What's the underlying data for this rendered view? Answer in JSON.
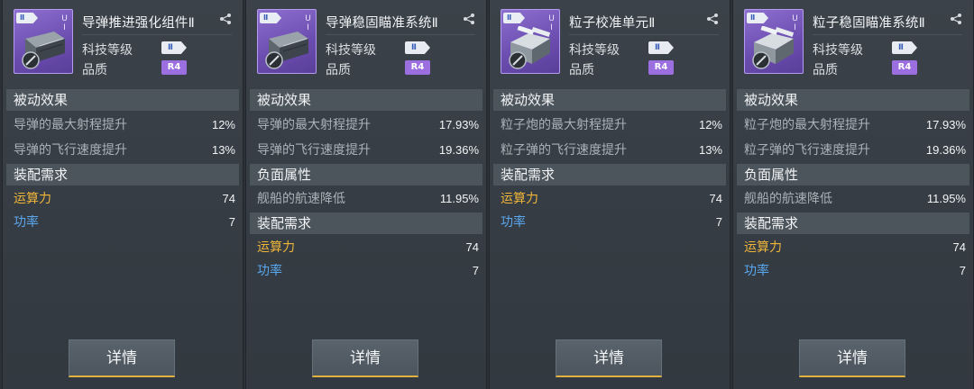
{
  "labels": {
    "tech_level": "科技等级",
    "quality": "品质",
    "passive_effects": "被动效果",
    "negative_attributes": "负面属性",
    "requirements": "装配需求",
    "compute": "运算力",
    "power": "功率",
    "details_button": "详情"
  },
  "colors": {
    "thumb_purple": "#7a5cc2",
    "quality_badge": "#9b6fe0",
    "compute_label": "#f0b63a",
    "power_label": "#5aa7ee",
    "button_underline": "#e2b23f"
  },
  "cards": [
    {
      "title": "导弹推进强化组件Ⅱ",
      "tier_chip": "Ⅱ",
      "side_mark": "U I",
      "level_badge": "Ⅱ",
      "quality_badge": "R4",
      "passives": [
        {
          "label": "导弹的最大射程提升",
          "value": "12%"
        },
        {
          "label": "导弹的飞行速度提升",
          "value": "13%"
        }
      ],
      "negatives": [],
      "compute": "74",
      "power": "7",
      "icon": "missile-module-icon"
    },
    {
      "title": "导弹稳固瞄准系统Ⅱ",
      "tier_chip": "Ⅱ",
      "side_mark": "U I",
      "level_badge": "Ⅱ",
      "quality_badge": "R4",
      "passives": [
        {
          "label": "导弹的最大射程提升",
          "value": "17.93%"
        },
        {
          "label": "导弹的飞行速度提升",
          "value": "19.36%"
        }
      ],
      "negatives": [
        {
          "label": "舰船的航速降低",
          "value": "11.95%"
        }
      ],
      "compute": "74",
      "power": "7",
      "icon": "missile-module-icon"
    },
    {
      "title": "粒子校准单元Ⅱ",
      "tier_chip": "Ⅱ",
      "side_mark": "U I",
      "level_badge": "Ⅱ",
      "quality_badge": "R4",
      "passives": [
        {
          "label": "粒子炮的最大射程提升",
          "value": "12%"
        },
        {
          "label": "粒子弹的飞行速度提升",
          "value": "13%"
        }
      ],
      "negatives": [],
      "compute": "74",
      "power": "7",
      "icon": "particle-module-icon"
    },
    {
      "title": "粒子稳固瞄准系统Ⅱ",
      "tier_chip": "Ⅱ",
      "side_mark": "U I",
      "level_badge": "Ⅱ",
      "quality_badge": "R4",
      "passives": [
        {
          "label": "粒子炮的最大射程提升",
          "value": "17.93%"
        },
        {
          "label": "粒子弹的飞行速度提升",
          "value": "19.36%"
        }
      ],
      "negatives": [
        {
          "label": "舰船的航速降低",
          "value": "11.95%"
        }
      ],
      "compute": "74",
      "power": "7",
      "icon": "particle-module-icon"
    }
  ]
}
